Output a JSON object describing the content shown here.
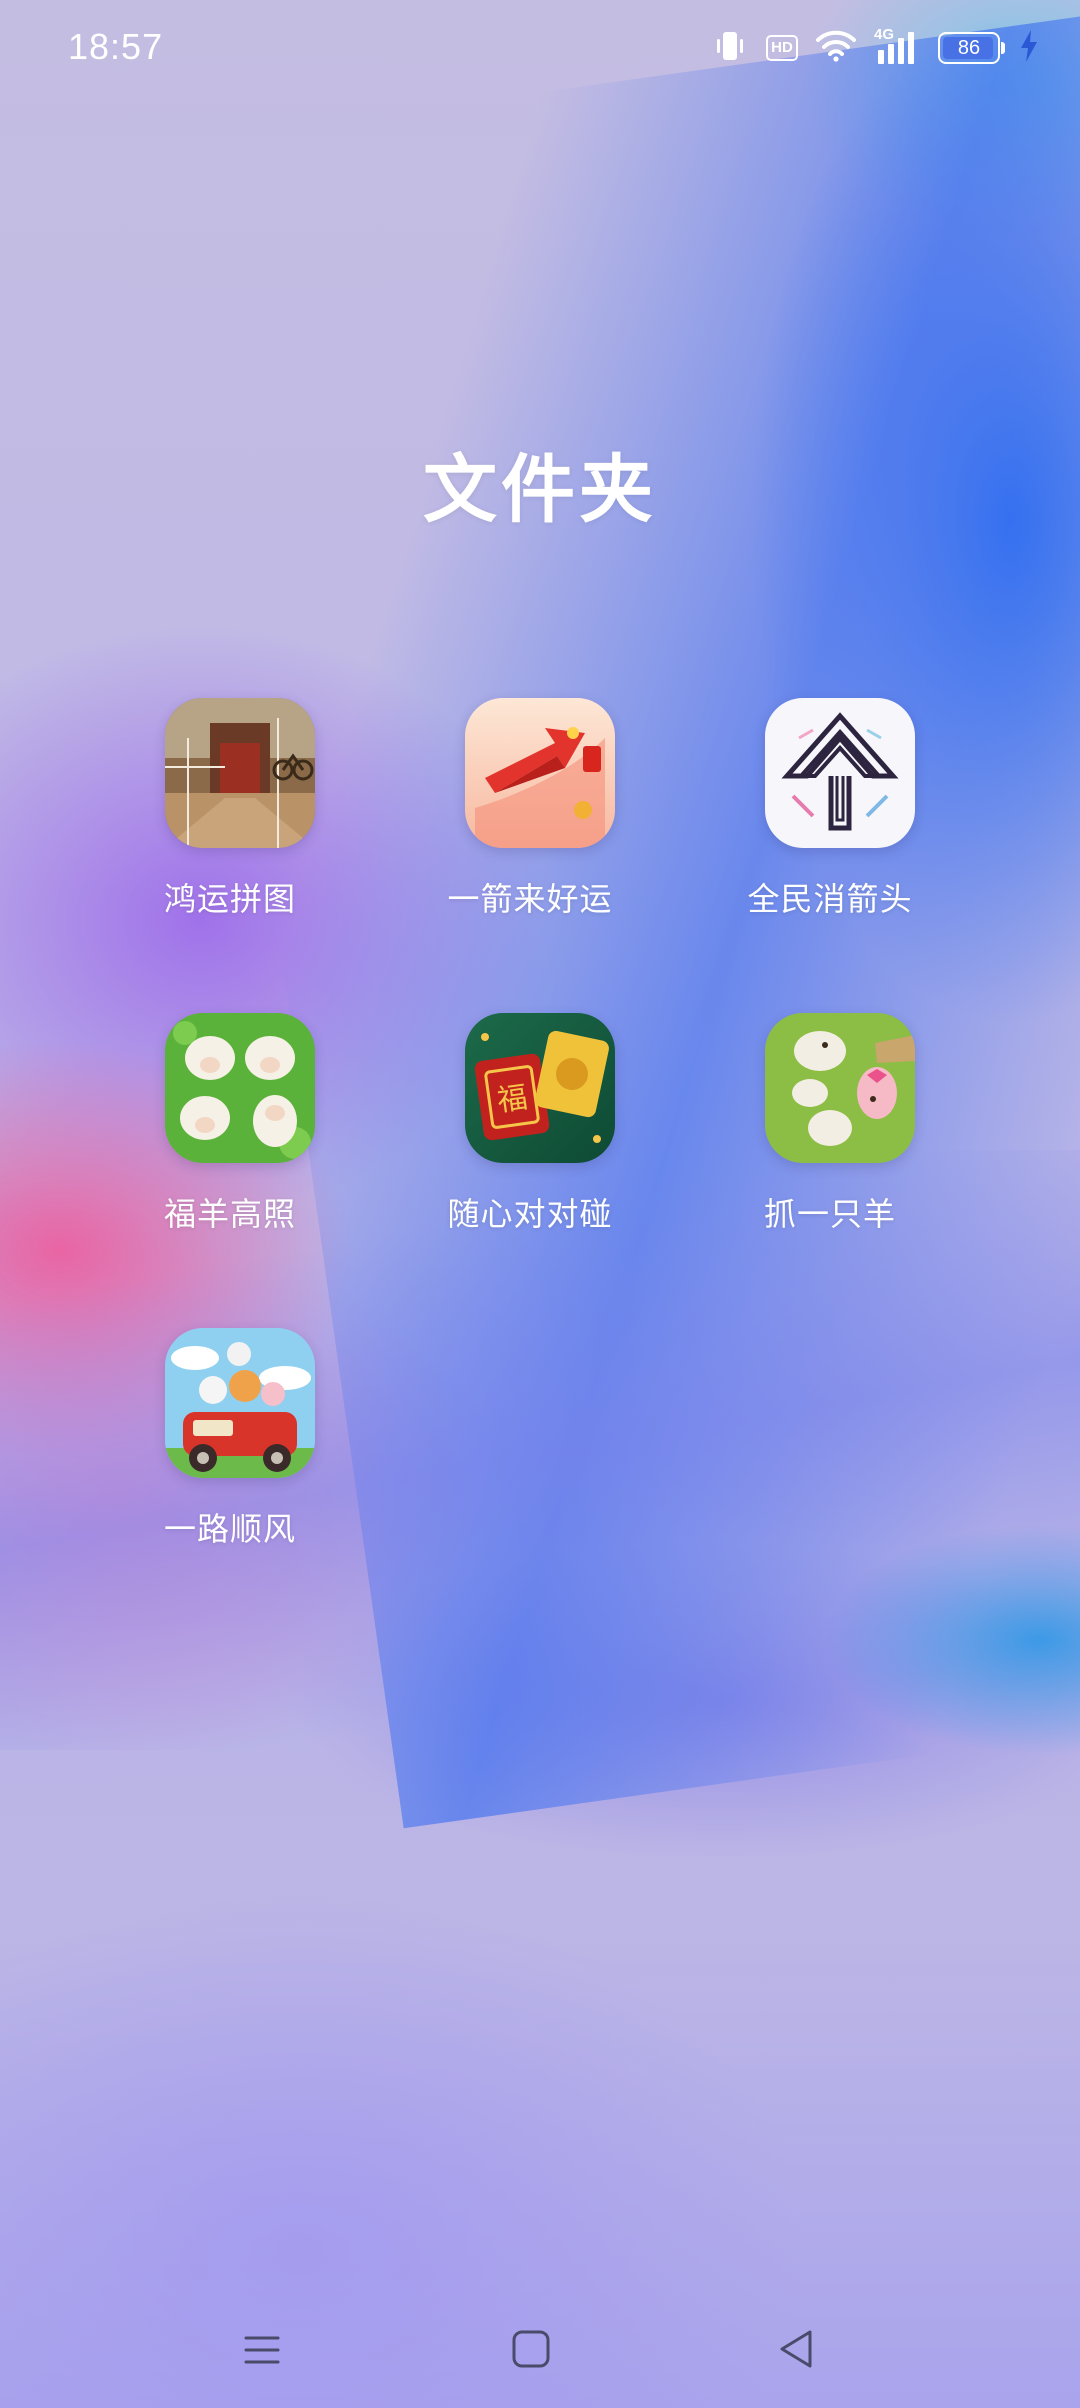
{
  "status_bar": {
    "time": "18:57",
    "hd_label": "HD",
    "network_label": "4G",
    "battery_level": "86",
    "icons": [
      "vibrate-icon",
      "hd-icon",
      "wifi-icon",
      "cellular-4g-icon",
      "battery-icon",
      "charging-icon"
    ]
  },
  "folder": {
    "title": "文件夹",
    "apps": [
      {
        "label": "鸿运拼图",
        "icon": "puzzle-hutong-icon"
      },
      {
        "label": "一箭来好运",
        "icon": "red-arrow-icon"
      },
      {
        "label": "全民消箭头",
        "icon": "arrow-maze-icon"
      },
      {
        "label": "福羊高照",
        "icon": "sheep-field-icon"
      },
      {
        "label": "随心对对碰",
        "icon": "fu-tiles-icon"
      },
      {
        "label": "抓一只羊",
        "icon": "grab-sheep-icon"
      },
      {
        "label": "一路顺风",
        "icon": "car-animals-icon"
      }
    ]
  },
  "nav_bar": {
    "buttons": [
      "menu-icon",
      "home-icon",
      "back-icon"
    ]
  },
  "colors": {
    "text": "#ffffff",
    "wallpaper_blue": "#3c6ef0",
    "wallpaper_pink": "#ec60a0",
    "wallpaper_lavender": "#bfb9e6"
  }
}
